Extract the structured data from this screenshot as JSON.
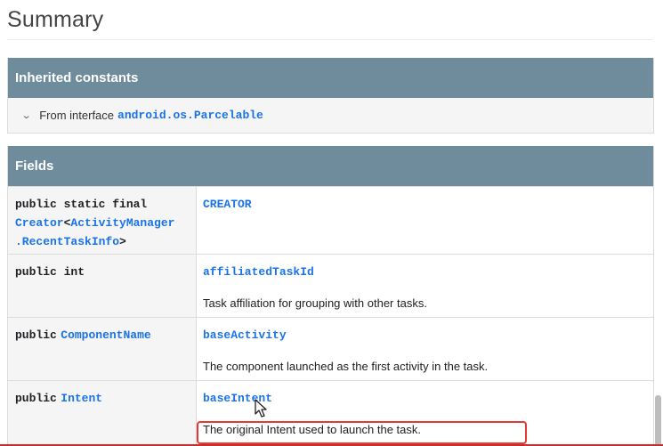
{
  "summary": {
    "title": "Summary"
  },
  "inherited_constants": {
    "header": "Inherited constants",
    "row": {
      "prefix": "From interface",
      "link": "android.os.Parcelable"
    }
  },
  "fields": {
    "header": "Fields",
    "rows": [
      {
        "type_lines": [
          {
            "keyword": "public static final",
            "link": ""
          },
          {
            "link": "Creator",
            "text": "<",
            "link2": "ActivityManager"
          },
          {
            "link": ".RecentTaskInfo",
            "text": ">"
          }
        ],
        "name": "CREATOR",
        "description": ""
      },
      {
        "type_keyword": "public int",
        "name": "affiliatedTaskId",
        "description": "Task affiliation for grouping with other tasks."
      },
      {
        "type_keyword": "public",
        "type_link": "ComponentName",
        "name": "baseActivity",
        "description": "The component launched as the first activity in the task."
      },
      {
        "type_keyword": "public",
        "type_link": "Intent",
        "name": "baseIntent",
        "description": "The original Intent used to launch the task."
      }
    ]
  },
  "colors": {
    "header_bg": "#6f8c9c",
    "link": "#1a73e8",
    "highlight": "#e53935"
  }
}
